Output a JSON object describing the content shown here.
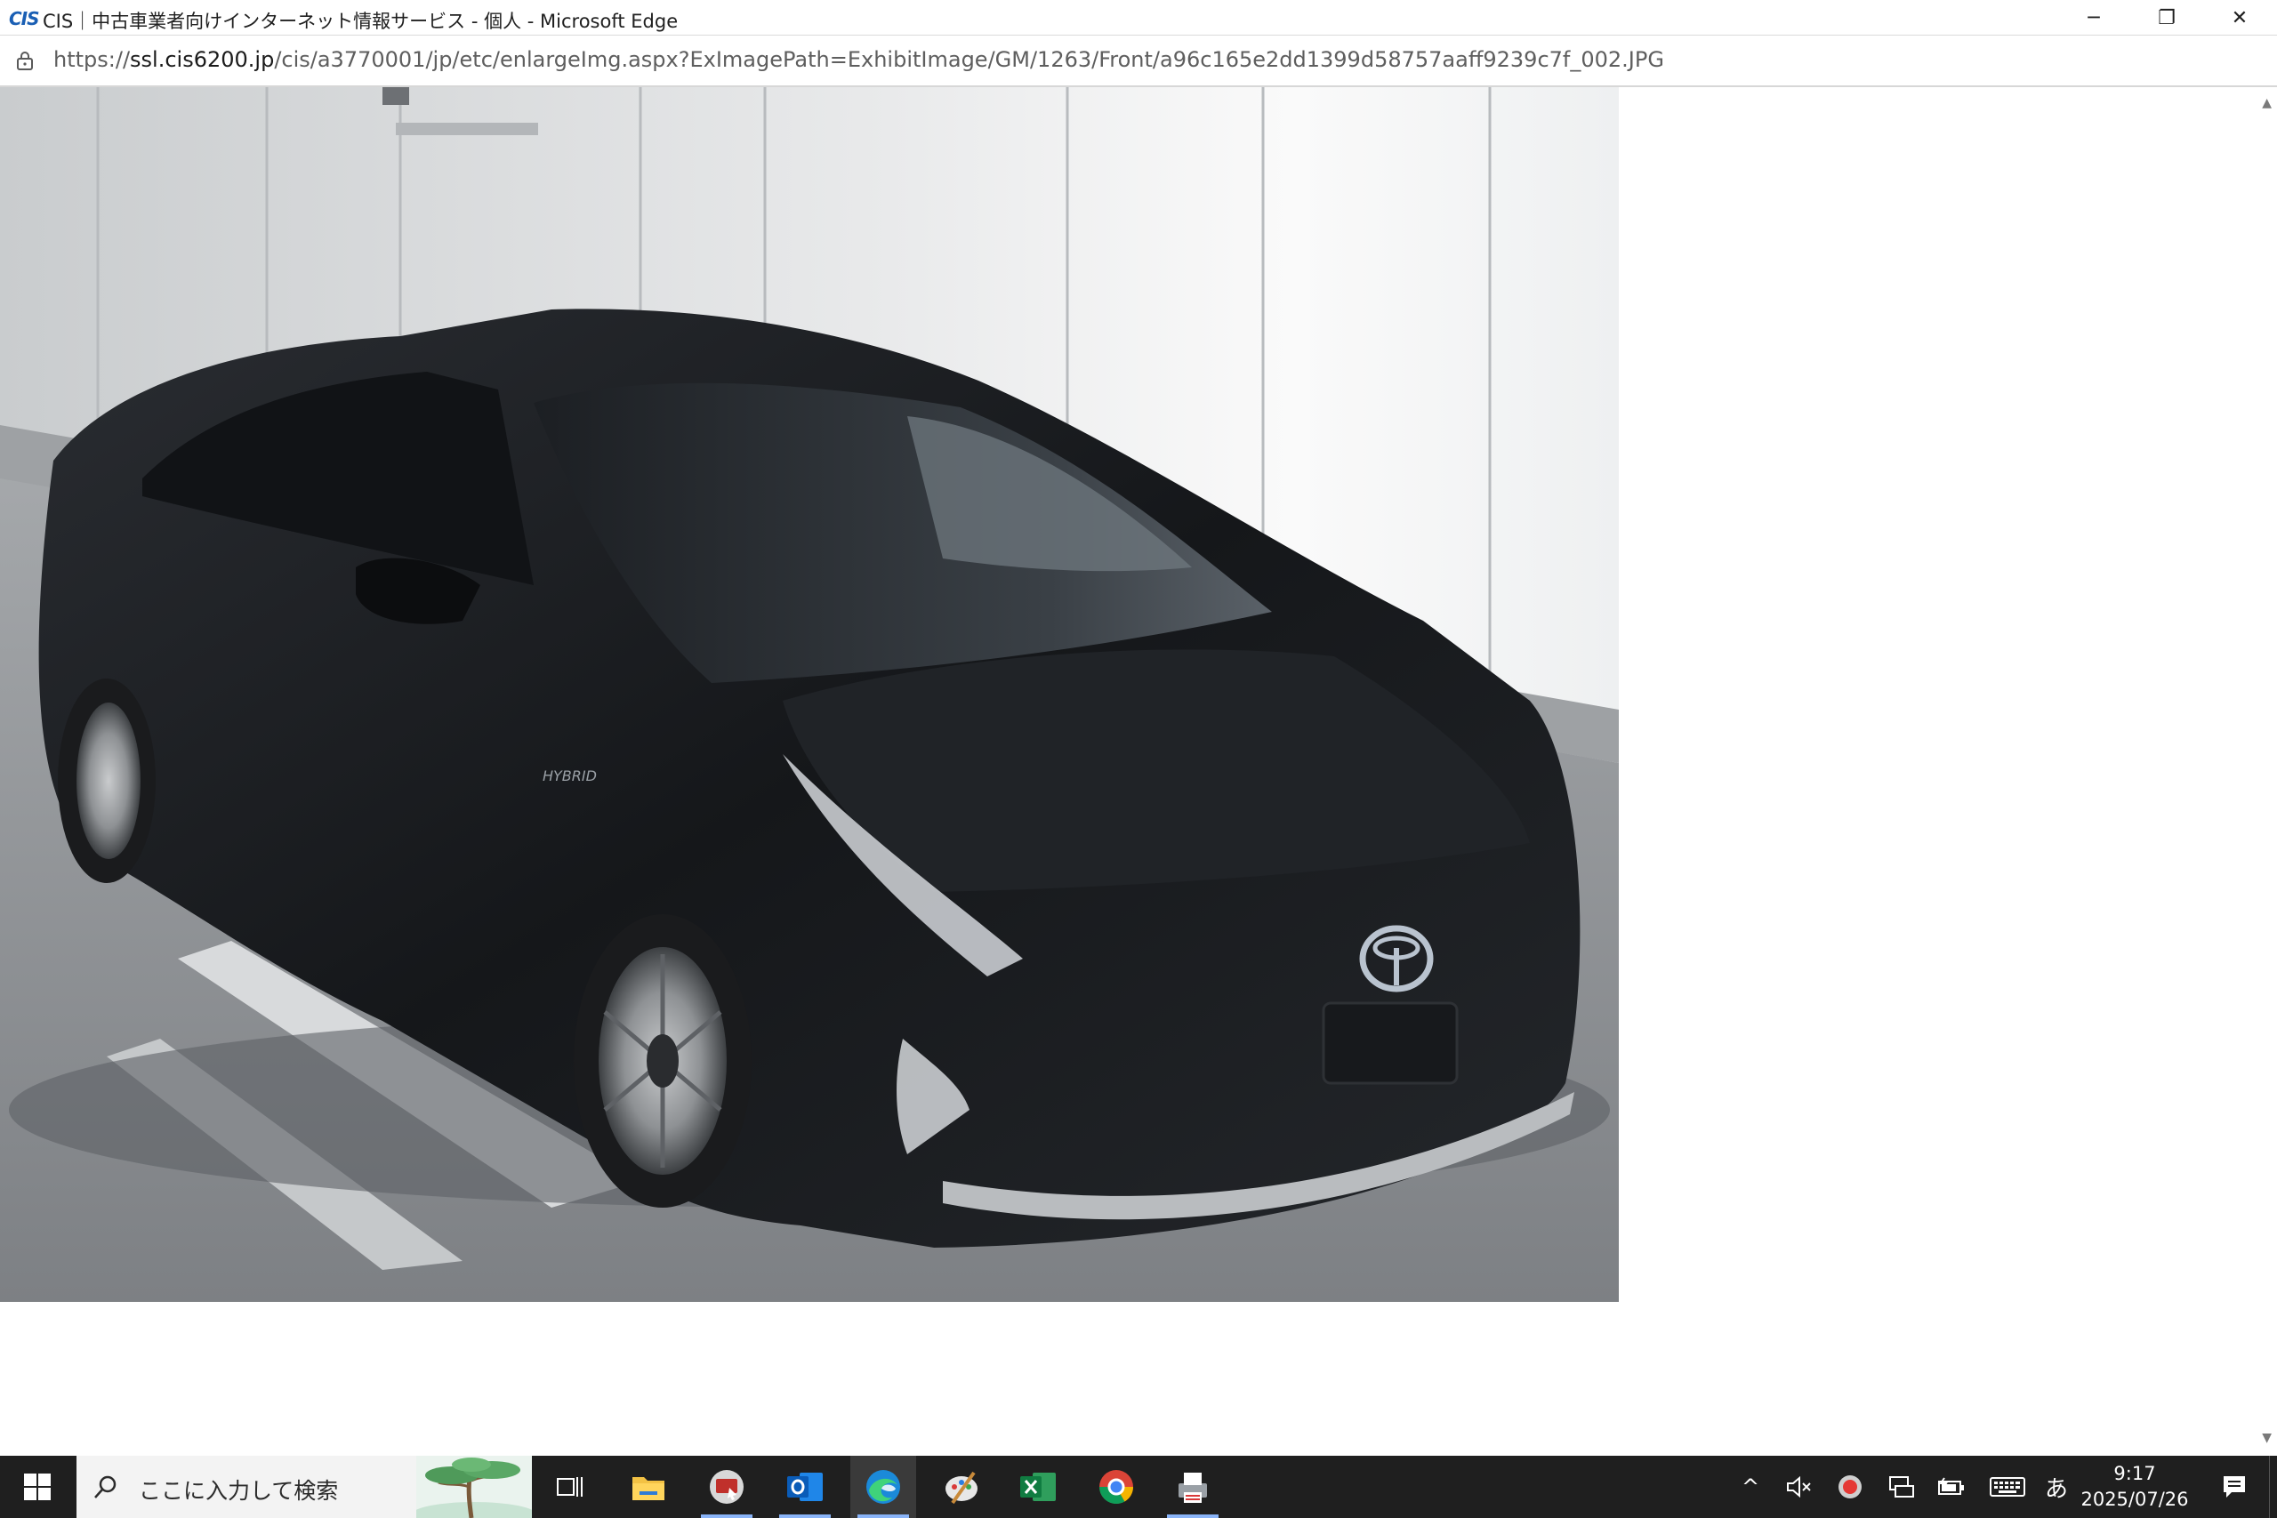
{
  "window": {
    "app_logo": "CIS",
    "title": "CIS｜中古車業者向けインターネット情報サービス - 個人 - Microsoft Edge",
    "minimize": "─",
    "restore": "❐",
    "close": "✕"
  },
  "address_bar": {
    "url_scheme": "https://",
    "url_host": "ssl.cis6200.jp",
    "url_path": "/cis/a3770001/jp/etc/enlargeImg.aspx?ExImagePath=ExhibitImage/GM/1263/Front/a96c165e2dd1399d58757aaff9239c7f_002.JPG"
  },
  "photo": {
    "badge_text": "HYBRID",
    "colors": {
      "car_body": "#1b1d21",
      "wall": "#e6e8ea",
      "floor": "#8c8f93",
      "toyota_emblem": "#b9c3cf"
    }
  },
  "taskbar": {
    "search_placeholder": "ここに入力して検索",
    "tray": {
      "chevron": "^",
      "ime": "あ",
      "time": "9:17",
      "date": "2025/07/26"
    }
  },
  "colors": {
    "taskbar_bg": "#1f1f1f",
    "accent": "#1a5fb4",
    "active_app_underline": "#8ab4f8"
  }
}
